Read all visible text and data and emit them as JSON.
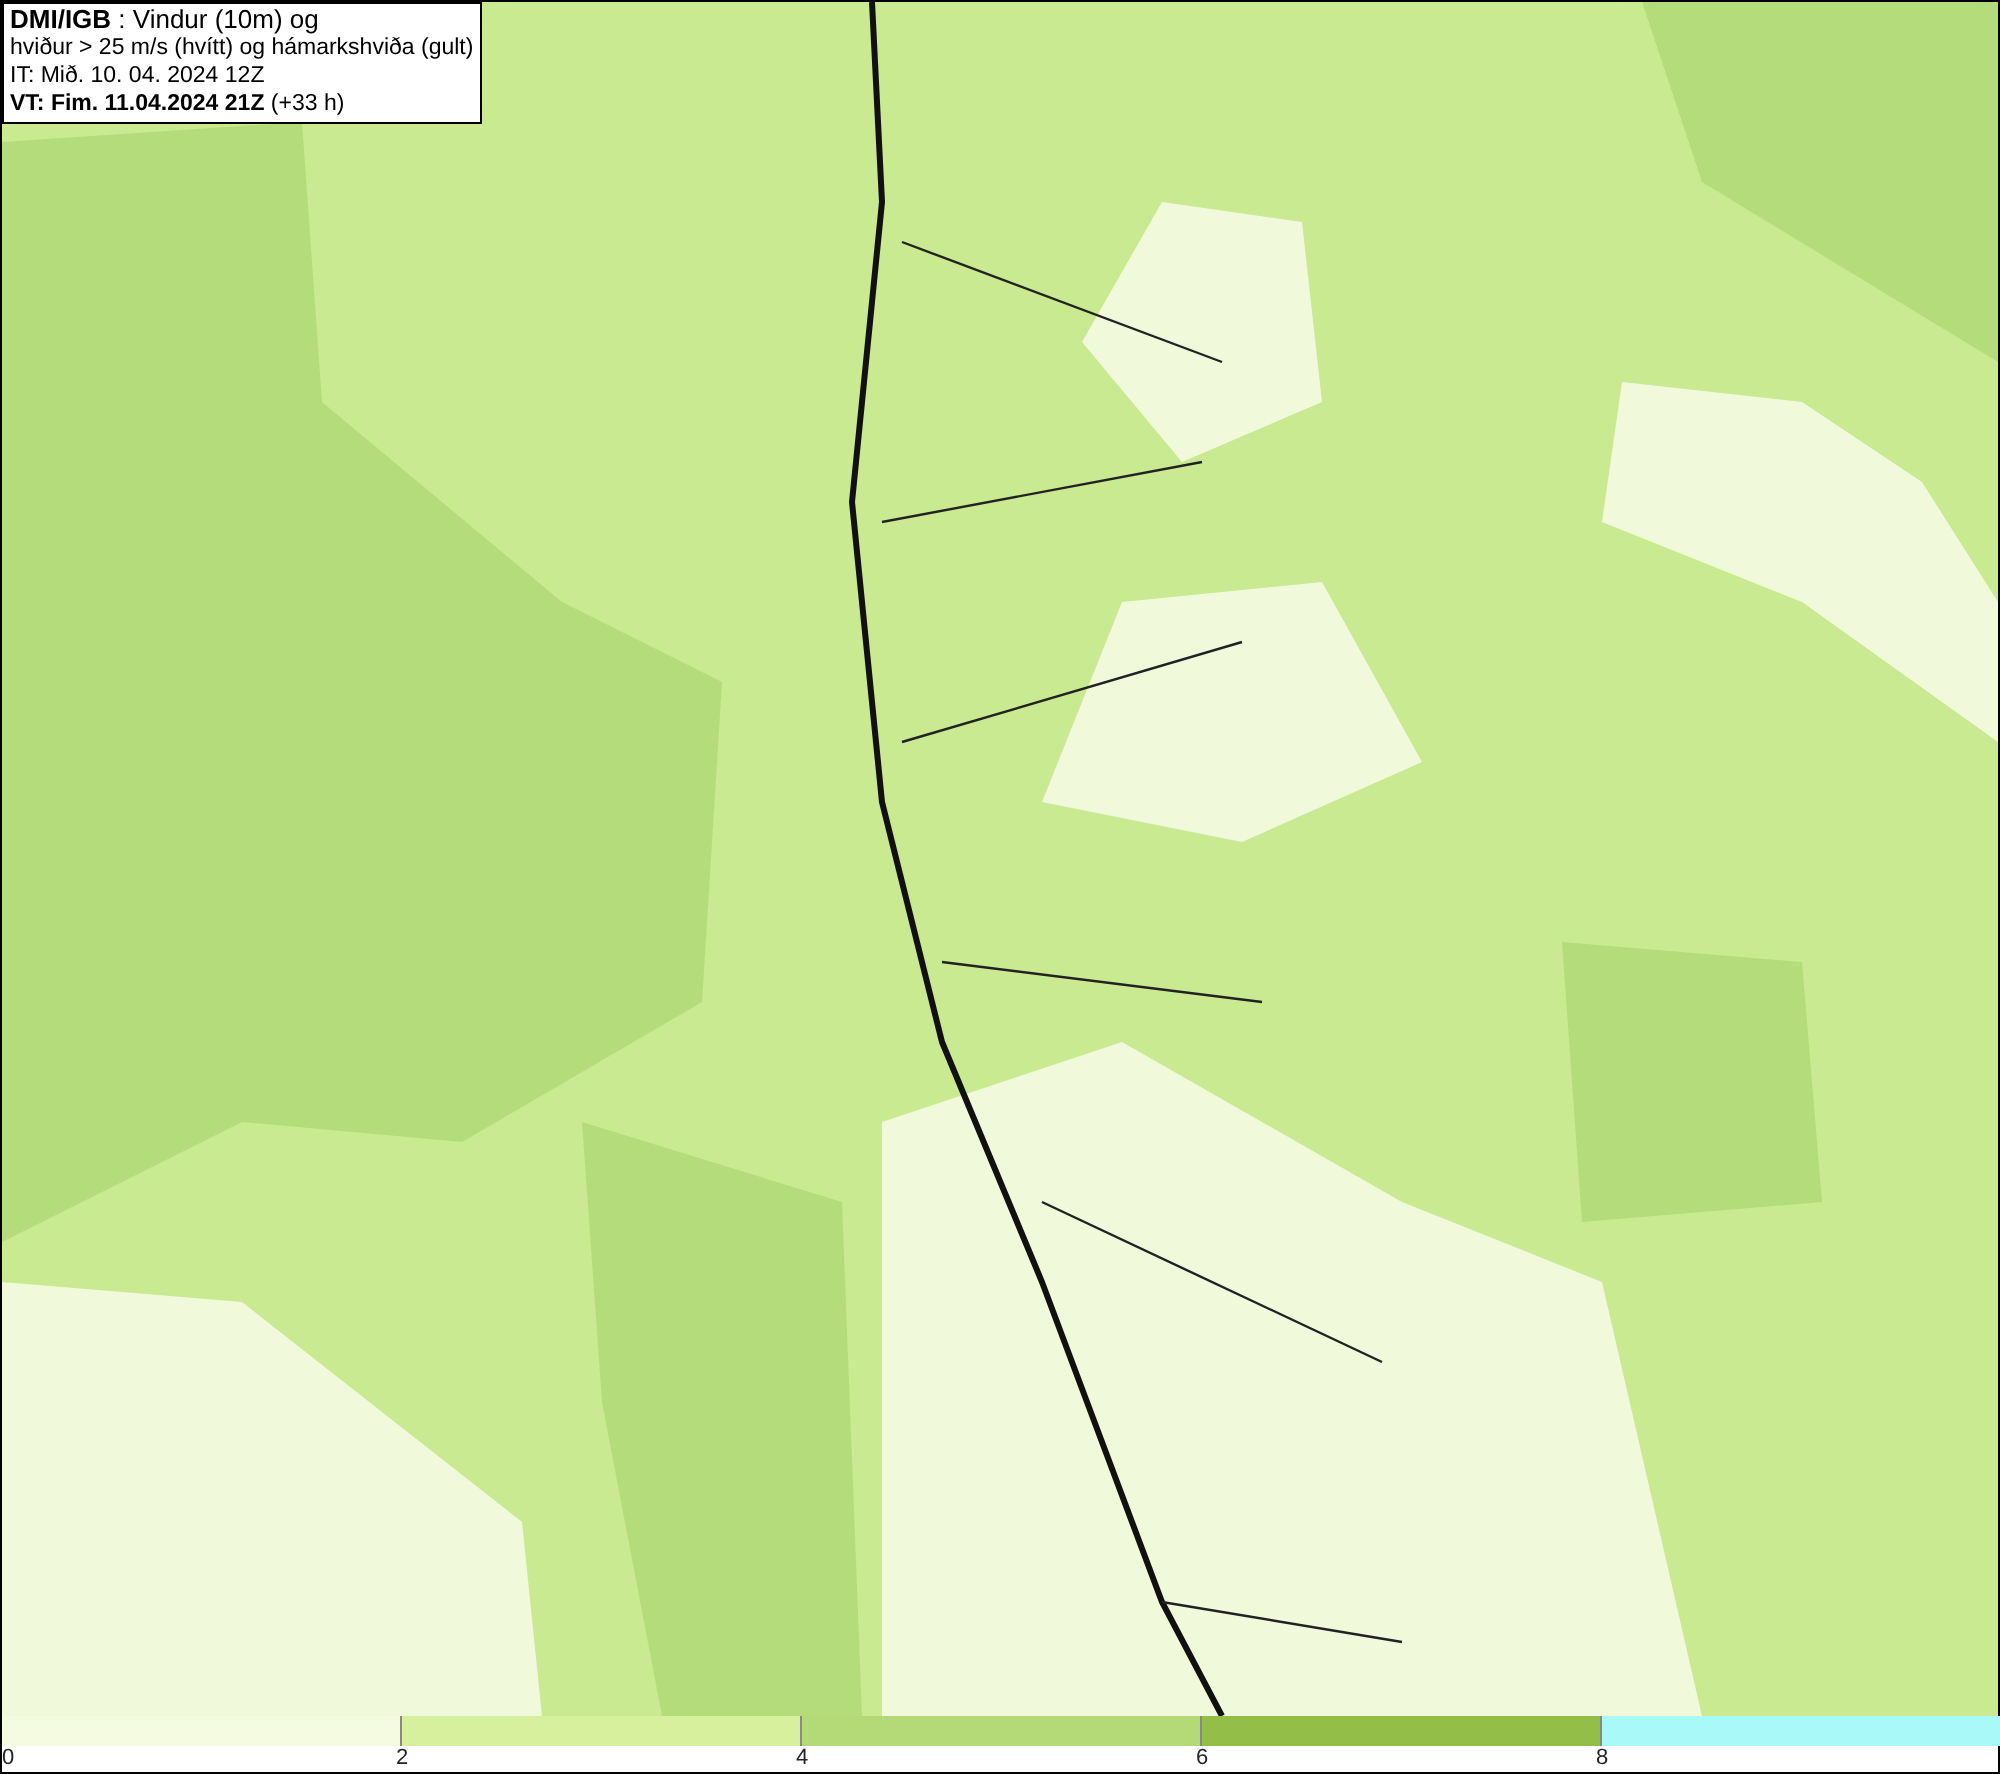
{
  "title_box": {
    "lines": [
      "**DMI/IGB** : Vindur (10m) og",
      "hviður > 25 m/s (hvítt) og hámarkshviða (gult)",
      "IT: Mið. 10. 04. 2024 12Z",
      "**VT: Fim. 11.04.2024 21Z** (+33 h)"
    ]
  },
  "legend": {
    "segments": [
      {
        "color": "#f4fbe0"
      },
      {
        "color": "#d6f09e"
      },
      {
        "color": "#b3da77"
      },
      {
        "color": "#93bf48"
      },
      {
        "color": "#aaf9f9"
      }
    ],
    "ticks": [
      "0",
      "2",
      "4",
      "6",
      "8"
    ]
  }
}
